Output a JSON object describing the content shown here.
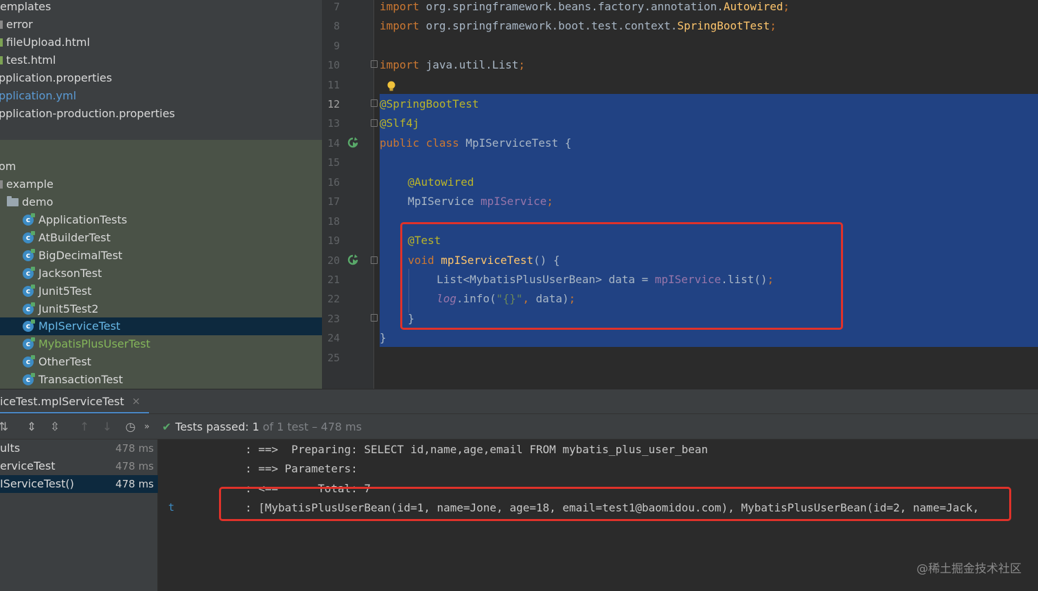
{
  "project_tree": {
    "rows": [
      {
        "label": "emplates"
      },
      {
        "label": "error"
      },
      {
        "label": "fileUpload.html"
      },
      {
        "label": "test.html"
      },
      {
        "label": "pplication.properties"
      },
      {
        "label": "pplication.yml"
      },
      {
        "label": "pplication-production.properties"
      },
      {
        "label": "om"
      },
      {
        "label": "example"
      },
      {
        "label": "demo"
      },
      {
        "label": "ApplicationTests"
      },
      {
        "label": "AtBuilderTest"
      },
      {
        "label": "BigDecimalTest"
      },
      {
        "label": "JacksonTest"
      },
      {
        "label": "Junit5Test"
      },
      {
        "label": "Junit5Test2"
      },
      {
        "label": "MpIServiceTest"
      },
      {
        "label": "MybatisPlusUserTest"
      },
      {
        "label": "OtherTest"
      },
      {
        "label": "TransactionTest"
      }
    ]
  },
  "editor": {
    "line_numbers": [
      "7",
      "8",
      "9",
      "10",
      "11",
      "12",
      "13",
      "14",
      "15",
      "16",
      "17",
      "18",
      "19",
      "20",
      "21",
      "22",
      "23",
      "24",
      "25"
    ],
    "current_line": "12",
    "code": {
      "l7_kw": "import",
      "l7_a": " org.springframework.beans.factory.annotation.",
      "l7_b": "Autowired",
      "l7_c": ";",
      "l8_kw": "import",
      "l8_a": " org.springframework.boot.test.context.",
      "l8_b": "SpringBootTest",
      "l8_c": ";",
      "l10_kw": "import",
      "l10_a": " java.util.List",
      "l10_c": ";",
      "l12": "@SpringBootTest",
      "l13": "@Slf4j",
      "l14_kw": "public class",
      "l14_a": " MpIServiceTest {",
      "l16": "@Autowired",
      "l17_a": "MpIService ",
      "l17_b": "mpIService",
      "l17_c": ";",
      "l19": "@Test",
      "l20_kw": "void ",
      "l20_m": "mpIServiceTest",
      "l20_a": "() {",
      "l21_a": "List<MybatisPlusUserBean> data = ",
      "l21_b": "mpIService",
      "l21_c": ".list()",
      "l21_d": ";",
      "l22_a": "log",
      "l22_b": ".info(",
      "l22_s": "\"{}\"",
      "l22_c": ", ",
      "l22_d": "data)",
      "l22_e": ";",
      "l23": "}",
      "l24": "}"
    }
  },
  "run_panel": {
    "tab_label": "iceTest.mpIServiceTest",
    "tab_close": "×",
    "status": {
      "prefix": "Tests passed: ",
      "count": "1",
      "suffix": " of 1 test – 478 ms"
    },
    "toolbar_icons": [
      "sort-icon",
      "expand-all-icon",
      "collapse-all-icon",
      "previous-failed-icon",
      "next-failed-icon",
      "history-icon",
      "more-icon"
    ],
    "tree": [
      {
        "name": "ults",
        "time": "478 ms"
      },
      {
        "name": "erviceTest",
        "time": "478 ms"
      },
      {
        "name": "IServiceTest()",
        "time": "478 ms"
      }
    ],
    "console": {
      "gutter_mark": "t",
      "lines": [
        ": ==>  Preparing: SELECT id,name,age,email FROM mybatis_plus_user_bean",
        ": ==> Parameters: ",
        ": <==      Total: 7",
        ": [MybatisPlusUserBean(id=1, name=Jone, age=18, email=test1@baomidou.com), MybatisPlusUserBean(id=2, name=Jack,"
      ]
    }
  },
  "watermark": "@稀土掘金技术社区",
  "colors": {
    "accent": "#214283",
    "highlight": "#e0322a",
    "pass": "#59a869"
  }
}
